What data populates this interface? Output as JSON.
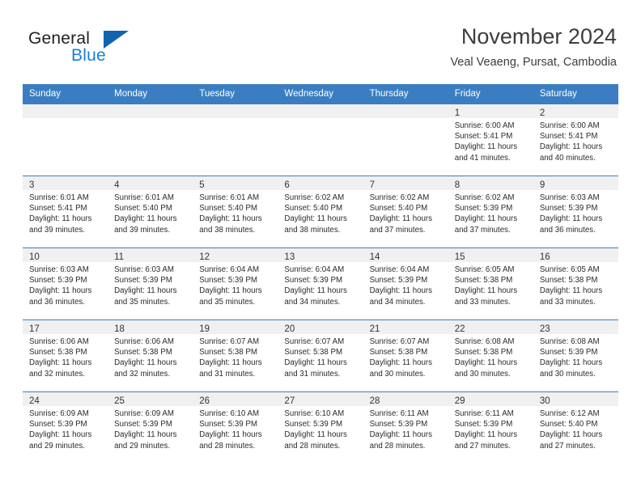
{
  "brand": {
    "word_general": "General",
    "word_blue": "Blue",
    "logo_icon": "triangle-logo-icon",
    "accent_color": "#1263ad",
    "blue_text_color": "#1b7fd4"
  },
  "header": {
    "title": "November 2024",
    "subtitle": "Veal Veaeng, Pursat, Cambodia"
  },
  "calendar": {
    "header_bg": "#3a7ec1",
    "daynum_bg": "#f0f0f0",
    "weekday_headers": [
      "Sunday",
      "Monday",
      "Tuesday",
      "Wednesday",
      "Thursday",
      "Friday",
      "Saturday"
    ],
    "weeks": [
      [
        {
          "day": "",
          "sunrise": "",
          "sunset": "",
          "daylight_1": "",
          "daylight_2": ""
        },
        {
          "day": "",
          "sunrise": "",
          "sunset": "",
          "daylight_1": "",
          "daylight_2": ""
        },
        {
          "day": "",
          "sunrise": "",
          "sunset": "",
          "daylight_1": "",
          "daylight_2": ""
        },
        {
          "day": "",
          "sunrise": "",
          "sunset": "",
          "daylight_1": "",
          "daylight_2": ""
        },
        {
          "day": "",
          "sunrise": "",
          "sunset": "",
          "daylight_1": "",
          "daylight_2": ""
        },
        {
          "day": "1",
          "sunrise": "Sunrise: 6:00 AM",
          "sunset": "Sunset: 5:41 PM",
          "daylight_1": "Daylight: 11 hours",
          "daylight_2": "and 41 minutes."
        },
        {
          "day": "2",
          "sunrise": "Sunrise: 6:00 AM",
          "sunset": "Sunset: 5:41 PM",
          "daylight_1": "Daylight: 11 hours",
          "daylight_2": "and 40 minutes."
        }
      ],
      [
        {
          "day": "3",
          "sunrise": "Sunrise: 6:01 AM",
          "sunset": "Sunset: 5:41 PM",
          "daylight_1": "Daylight: 11 hours",
          "daylight_2": "and 39 minutes."
        },
        {
          "day": "4",
          "sunrise": "Sunrise: 6:01 AM",
          "sunset": "Sunset: 5:40 PM",
          "daylight_1": "Daylight: 11 hours",
          "daylight_2": "and 39 minutes."
        },
        {
          "day": "5",
          "sunrise": "Sunrise: 6:01 AM",
          "sunset": "Sunset: 5:40 PM",
          "daylight_1": "Daylight: 11 hours",
          "daylight_2": "and 38 minutes."
        },
        {
          "day": "6",
          "sunrise": "Sunrise: 6:02 AM",
          "sunset": "Sunset: 5:40 PM",
          "daylight_1": "Daylight: 11 hours",
          "daylight_2": "and 38 minutes."
        },
        {
          "day": "7",
          "sunrise": "Sunrise: 6:02 AM",
          "sunset": "Sunset: 5:40 PM",
          "daylight_1": "Daylight: 11 hours",
          "daylight_2": "and 37 minutes."
        },
        {
          "day": "8",
          "sunrise": "Sunrise: 6:02 AM",
          "sunset": "Sunset: 5:39 PM",
          "daylight_1": "Daylight: 11 hours",
          "daylight_2": "and 37 minutes."
        },
        {
          "day": "9",
          "sunrise": "Sunrise: 6:03 AM",
          "sunset": "Sunset: 5:39 PM",
          "daylight_1": "Daylight: 11 hours",
          "daylight_2": "and 36 minutes."
        }
      ],
      [
        {
          "day": "10",
          "sunrise": "Sunrise: 6:03 AM",
          "sunset": "Sunset: 5:39 PM",
          "daylight_1": "Daylight: 11 hours",
          "daylight_2": "and 36 minutes."
        },
        {
          "day": "11",
          "sunrise": "Sunrise: 6:03 AM",
          "sunset": "Sunset: 5:39 PM",
          "daylight_1": "Daylight: 11 hours",
          "daylight_2": "and 35 minutes."
        },
        {
          "day": "12",
          "sunrise": "Sunrise: 6:04 AM",
          "sunset": "Sunset: 5:39 PM",
          "daylight_1": "Daylight: 11 hours",
          "daylight_2": "and 35 minutes."
        },
        {
          "day": "13",
          "sunrise": "Sunrise: 6:04 AM",
          "sunset": "Sunset: 5:39 PM",
          "daylight_1": "Daylight: 11 hours",
          "daylight_2": "and 34 minutes."
        },
        {
          "day": "14",
          "sunrise": "Sunrise: 6:04 AM",
          "sunset": "Sunset: 5:39 PM",
          "daylight_1": "Daylight: 11 hours",
          "daylight_2": "and 34 minutes."
        },
        {
          "day": "15",
          "sunrise": "Sunrise: 6:05 AM",
          "sunset": "Sunset: 5:38 PM",
          "daylight_1": "Daylight: 11 hours",
          "daylight_2": "and 33 minutes."
        },
        {
          "day": "16",
          "sunrise": "Sunrise: 6:05 AM",
          "sunset": "Sunset: 5:38 PM",
          "daylight_1": "Daylight: 11 hours",
          "daylight_2": "and 33 minutes."
        }
      ],
      [
        {
          "day": "17",
          "sunrise": "Sunrise: 6:06 AM",
          "sunset": "Sunset: 5:38 PM",
          "daylight_1": "Daylight: 11 hours",
          "daylight_2": "and 32 minutes."
        },
        {
          "day": "18",
          "sunrise": "Sunrise: 6:06 AM",
          "sunset": "Sunset: 5:38 PM",
          "daylight_1": "Daylight: 11 hours",
          "daylight_2": "and 32 minutes."
        },
        {
          "day": "19",
          "sunrise": "Sunrise: 6:07 AM",
          "sunset": "Sunset: 5:38 PM",
          "daylight_1": "Daylight: 11 hours",
          "daylight_2": "and 31 minutes."
        },
        {
          "day": "20",
          "sunrise": "Sunrise: 6:07 AM",
          "sunset": "Sunset: 5:38 PM",
          "daylight_1": "Daylight: 11 hours",
          "daylight_2": "and 31 minutes."
        },
        {
          "day": "21",
          "sunrise": "Sunrise: 6:07 AM",
          "sunset": "Sunset: 5:38 PM",
          "daylight_1": "Daylight: 11 hours",
          "daylight_2": "and 30 minutes."
        },
        {
          "day": "22",
          "sunrise": "Sunrise: 6:08 AM",
          "sunset": "Sunset: 5:38 PM",
          "daylight_1": "Daylight: 11 hours",
          "daylight_2": "and 30 minutes."
        },
        {
          "day": "23",
          "sunrise": "Sunrise: 6:08 AM",
          "sunset": "Sunset: 5:39 PM",
          "daylight_1": "Daylight: 11 hours",
          "daylight_2": "and 30 minutes."
        }
      ],
      [
        {
          "day": "24",
          "sunrise": "Sunrise: 6:09 AM",
          "sunset": "Sunset: 5:39 PM",
          "daylight_1": "Daylight: 11 hours",
          "daylight_2": "and 29 minutes."
        },
        {
          "day": "25",
          "sunrise": "Sunrise: 6:09 AM",
          "sunset": "Sunset: 5:39 PM",
          "daylight_1": "Daylight: 11 hours",
          "daylight_2": "and 29 minutes."
        },
        {
          "day": "26",
          "sunrise": "Sunrise: 6:10 AM",
          "sunset": "Sunset: 5:39 PM",
          "daylight_1": "Daylight: 11 hours",
          "daylight_2": "and 28 minutes."
        },
        {
          "day": "27",
          "sunrise": "Sunrise: 6:10 AM",
          "sunset": "Sunset: 5:39 PM",
          "daylight_1": "Daylight: 11 hours",
          "daylight_2": "and 28 minutes."
        },
        {
          "day": "28",
          "sunrise": "Sunrise: 6:11 AM",
          "sunset": "Sunset: 5:39 PM",
          "daylight_1": "Daylight: 11 hours",
          "daylight_2": "and 28 minutes."
        },
        {
          "day": "29",
          "sunrise": "Sunrise: 6:11 AM",
          "sunset": "Sunset: 5:39 PM",
          "daylight_1": "Daylight: 11 hours",
          "daylight_2": "and 27 minutes."
        },
        {
          "day": "30",
          "sunrise": "Sunrise: 6:12 AM",
          "sunset": "Sunset: 5:40 PM",
          "daylight_1": "Daylight: 11 hours",
          "daylight_2": "and 27 minutes."
        }
      ]
    ]
  }
}
